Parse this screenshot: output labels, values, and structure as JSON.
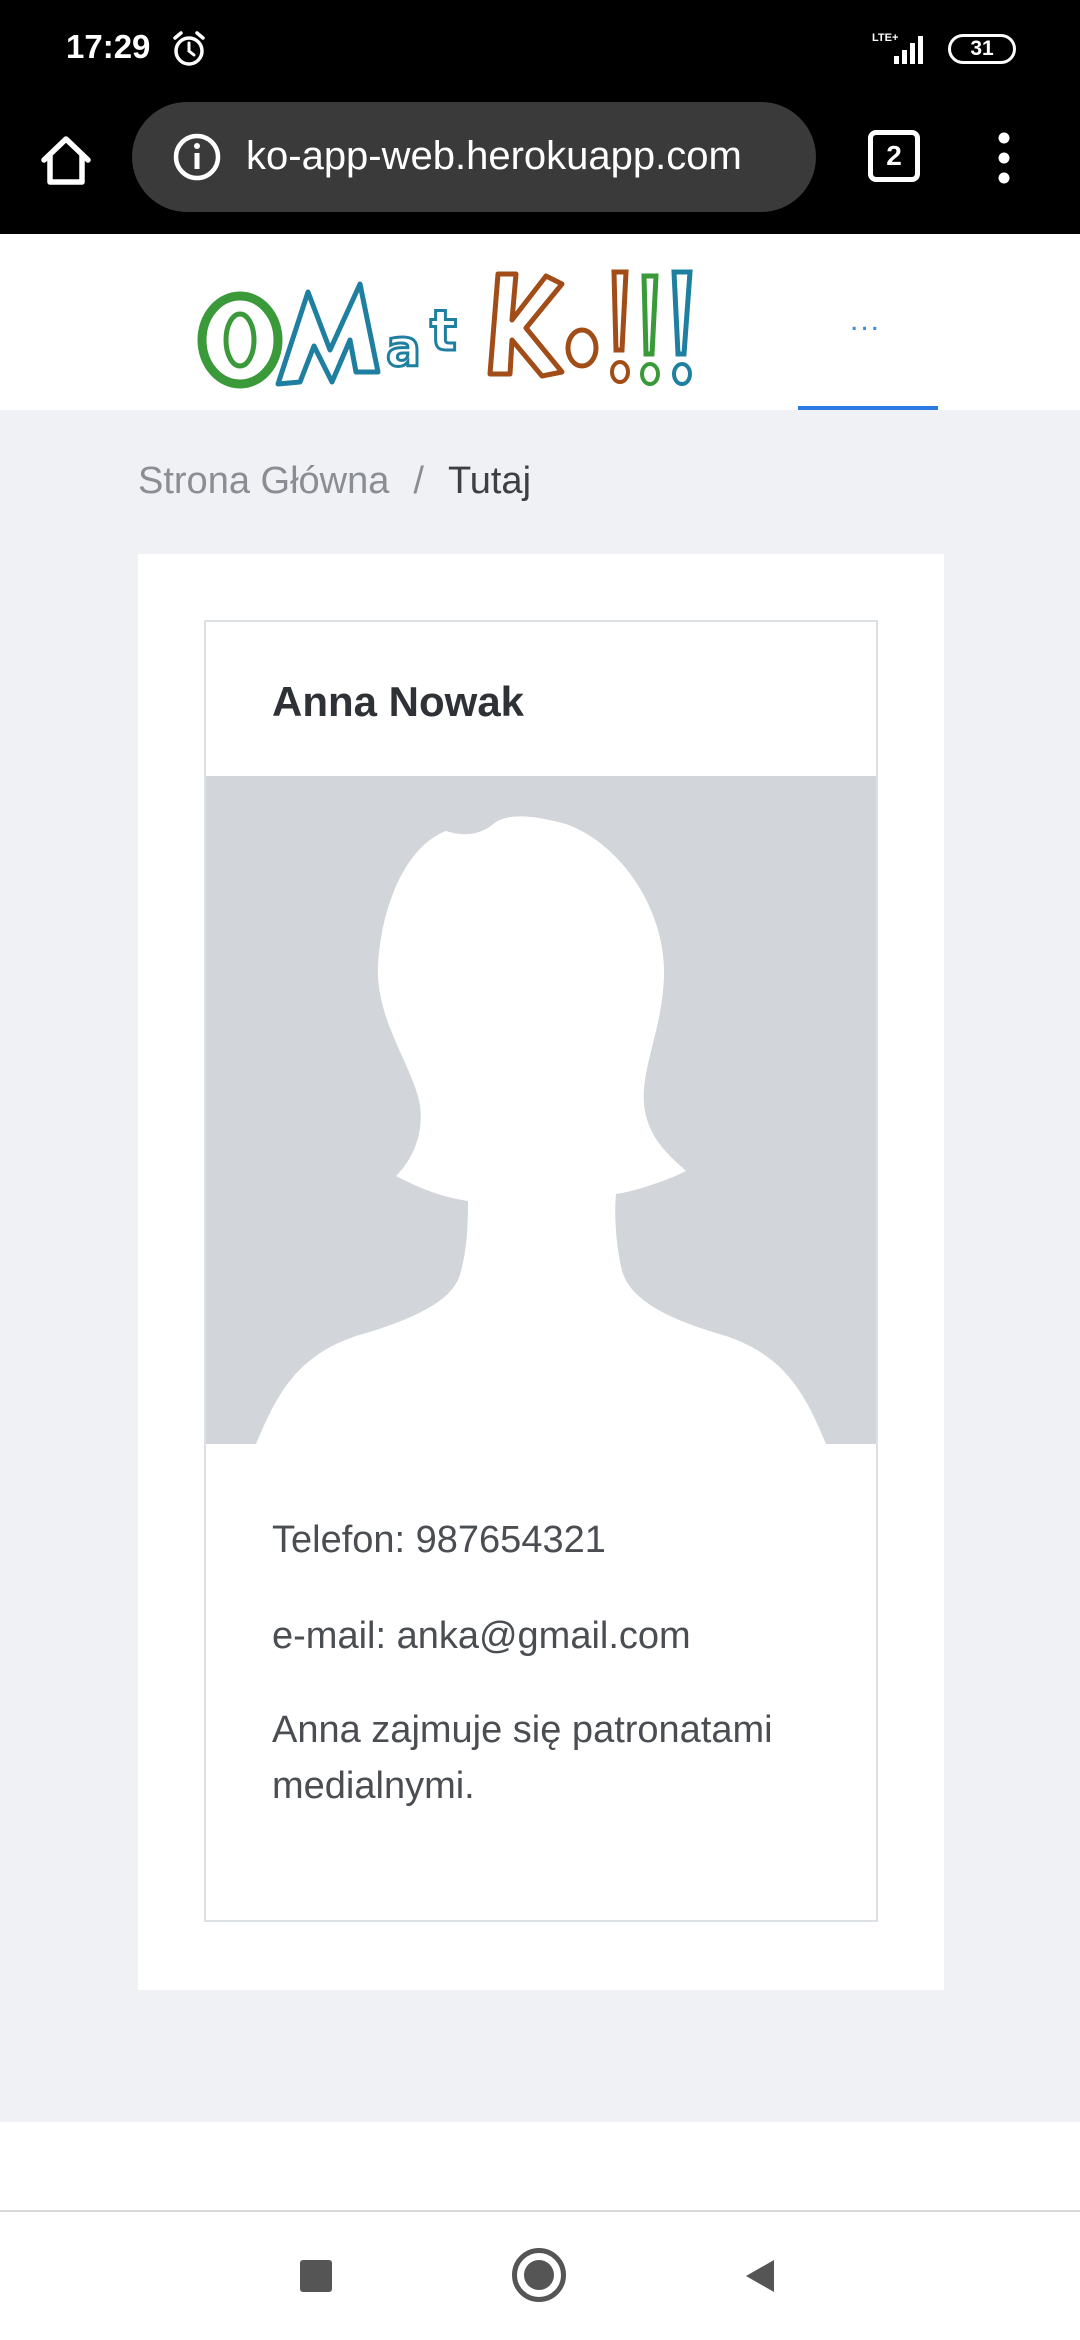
{
  "status_bar": {
    "time": "17:29",
    "network": "LTE+",
    "battery": "31"
  },
  "browser": {
    "url": "ko-app-web.herokuapp.com",
    "tab_count": "2"
  },
  "site": {
    "logo_text": "OMatKo!!!",
    "menu_label": "...",
    "accent_color": "#2c7be5"
  },
  "breadcrumb": {
    "home": "Strona Główna",
    "separator": "/",
    "current": "Tutaj"
  },
  "profile": {
    "name": "Anna Nowak",
    "phone": "Telefon: 987654321",
    "email": "e-mail: anka@gmail.com",
    "description": "Anna zajmuje się patronatami medialnymi."
  },
  "icons": {
    "alarm": "alarm-icon",
    "signal": "signal-icon",
    "battery": "battery-icon",
    "home": "home-icon",
    "info": "info-icon",
    "tabs": "tabs-icon",
    "more": "more-vert-icon",
    "avatar": "person-silhouette",
    "nav_recents": "square-icon",
    "nav_home": "circle-icon",
    "nav_back": "triangle-back-icon"
  }
}
